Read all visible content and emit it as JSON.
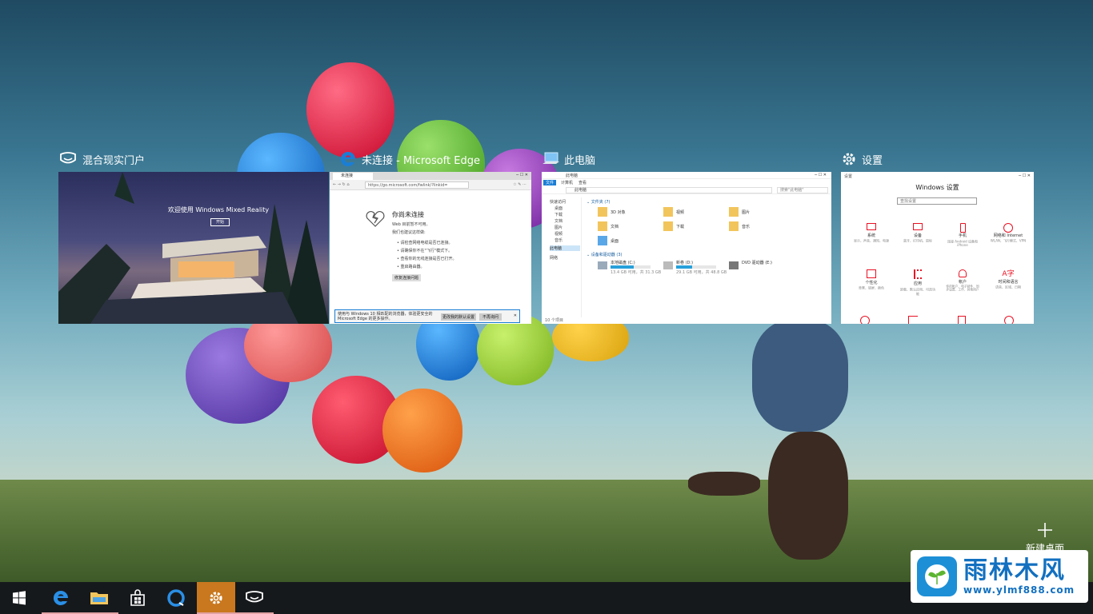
{
  "task_view": {
    "windows": [
      {
        "title": "混合现实门户",
        "content": {
          "welcome": "欢迎使用 Windows Mixed Reality",
          "button": "开始"
        }
      },
      {
        "title": "未连接 - Microsoft Edge",
        "content": {
          "tab": "未连接",
          "url": "https://go.microsoft.com/fwlink/?linkid=",
          "heading": "你尚未连接",
          "sub": "Web 目前暂不可用。",
          "try_label": "我们也建议这样做:",
          "items": [
            "请检查网络电缆是否已连接。",
            "请确保你不在\"飞行\"模式下。",
            "查看你的无线连接是否已打开。",
            "重启路由器。"
          ],
          "diag_button": "修复连接问题",
          "banner": "使用与 Windows 10 相匹配的浏览器，体验更安全的 Microsoft Edge 的更多操作。",
          "banner_btn1": "更改我的默认设置",
          "banner_btn2": "不再询问"
        }
      },
      {
        "title": "此电脑",
        "content": {
          "title": "此电脑",
          "ribbon_tabs": [
            "文件",
            "计算机",
            "查看"
          ],
          "path": "此电脑",
          "search": "搜索\"此电脑\"",
          "nav": [
            "快速访问",
            "桌面",
            "下载",
            "文档",
            "图片",
            "视频",
            "音乐",
            "此电脑",
            "网络"
          ],
          "folders_header": "文件夹 (7)",
          "folders": [
            "3D 对象",
            "视频",
            "图片",
            "文档",
            "下载",
            "音乐",
            "桌面"
          ],
          "drives_header": "设备和驱动器 (3)",
          "drives": [
            {
              "name": "本地磁盘 (C:)",
              "info": "13.4 GB 可用，共 31.3 GB"
            },
            {
              "name": "新卷 (D:)",
              "info": "29.1 GB 可用，共 48.8 GB"
            },
            {
              "name": "DVD 驱动器 (E:)",
              "info": ""
            }
          ],
          "status": "10 个项目"
        }
      },
      {
        "title": "设置",
        "content": {
          "app_label": "设置",
          "heading": "Windows 设置",
          "search": "查找设置",
          "items": [
            {
              "name": "系统",
              "desc": "显示、声音、通知、电源"
            },
            {
              "name": "设备",
              "desc": "蓝牙、打印机、鼠标"
            },
            {
              "name": "手机",
              "desc": "连接 Android 设备和 iPhone"
            },
            {
              "name": "网络和 Internet",
              "desc": "WLAN、飞行模式、VPN"
            },
            {
              "name": "个性化",
              "desc": "背景、锁屏、颜色"
            },
            {
              "name": "应用",
              "desc": "卸载、默认应用、可选功能"
            },
            {
              "name": "帐户",
              "desc": "你的帐户、电子邮件、同步设置、工作、其他用户"
            },
            {
              "name": "时间和语言",
              "desc": "语音、区域、日期"
            }
          ]
        }
      }
    ],
    "new_desktop": "新建桌面"
  },
  "taskbar": {
    "items": [
      "start",
      "edge",
      "file-explorer",
      "store",
      "cortana",
      "settings",
      "mixed-reality-portal"
    ],
    "active": "settings"
  },
  "watermark": {
    "brand": "雨林木风",
    "url": "www.ylmf888.com"
  },
  "colors": {
    "accent": "#c9781f",
    "settings_red": "#e81123",
    "edge_blue": "#1a7ed6",
    "taskbar": "#16191c"
  }
}
